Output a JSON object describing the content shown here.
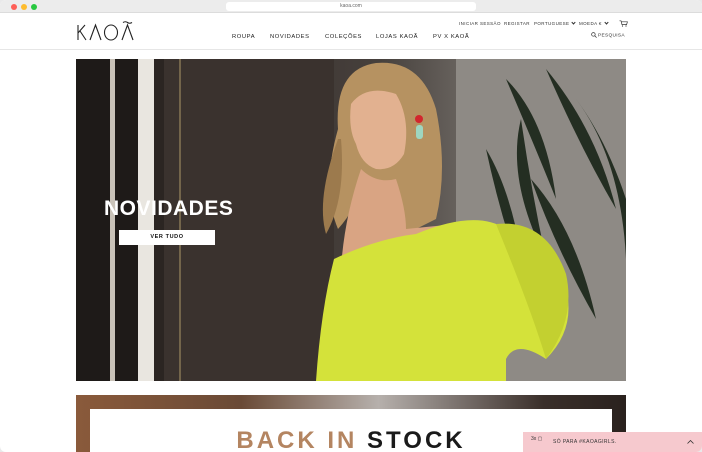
{
  "browser": {
    "url": "kaoa.com"
  },
  "header": {
    "logo_text": "KAOÃ",
    "utility": {
      "login": "INICIAR SESSÃO",
      "register": "REGISTAR",
      "language": "PORTUGUESE",
      "currency": "MOEDA €"
    },
    "nav": [
      "ROUPA",
      "NOVIDADES",
      "COLEÇÕES",
      "LOJAS KAOÃ",
      "PV X KAOÃ"
    ],
    "search_label": "PESQUISA"
  },
  "hero": {
    "title": "NOVIDADES",
    "button_label": "VER TUDO"
  },
  "banner2": {
    "title_part1": "BACK IN ",
    "title_part2": "STOCK"
  },
  "promo": {
    "badge": "3x",
    "text": "SÓ PARA #KAOAGIRLS."
  },
  "colors": {
    "accent_yellow": "#d4e23a",
    "promo_pink": "#f6c9ce",
    "text_dark": "#222222"
  },
  "icons": {
    "cart": "cart-icon",
    "search": "search-icon",
    "gift": "gift-icon",
    "chevron": "chevron-up-icon"
  }
}
